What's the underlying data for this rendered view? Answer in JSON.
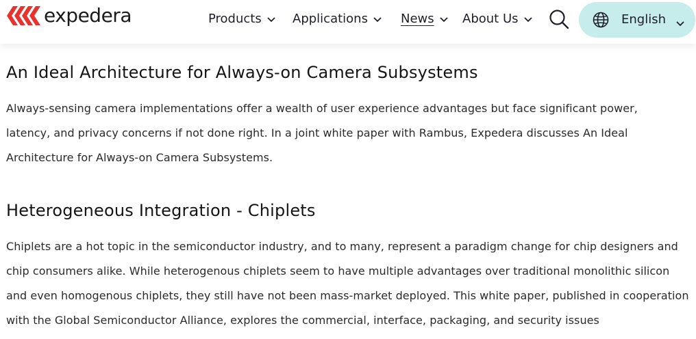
{
  "header": {
    "logo_text": "expedera",
    "nav": {
      "products": "Products",
      "applications": "Applications",
      "news": "News",
      "about": "About Us"
    },
    "search_icon": "search-icon",
    "language": {
      "label": "English",
      "icon": "globe-icon"
    }
  },
  "colors": {
    "logo_red": "#e8322d",
    "lang_bg": "#c6eceb",
    "text": "#1a1a1a"
  },
  "articles": [
    {
      "title": "An Ideal Architecture for Always-on Camera Subsystems",
      "body": "Always-sensing camera implementations offer a wealth of user experience advantages but face significant power, latency, and privacy concerns if not done right. In a joint white paper with Rambus, Expedera discusses An Ideal Architecture for Always-on Camera Subsystems."
    },
    {
      "title": "Heterogeneous Integration - Chiplets",
      "body": "Chiplets are a hot topic in the semiconductor industry, and to many, represent a paradigm change for chip designers and chip consumers alike. While heterogenous chiplets seem to have multiple advantages over traditional monolithic silicon and even homogenous chiplets, they still have not been mass-market deployed. This white paper, published in cooperation with the Global Semiconductor Alliance, explores the commercial, interface, packaging, and security issues"
    }
  ]
}
